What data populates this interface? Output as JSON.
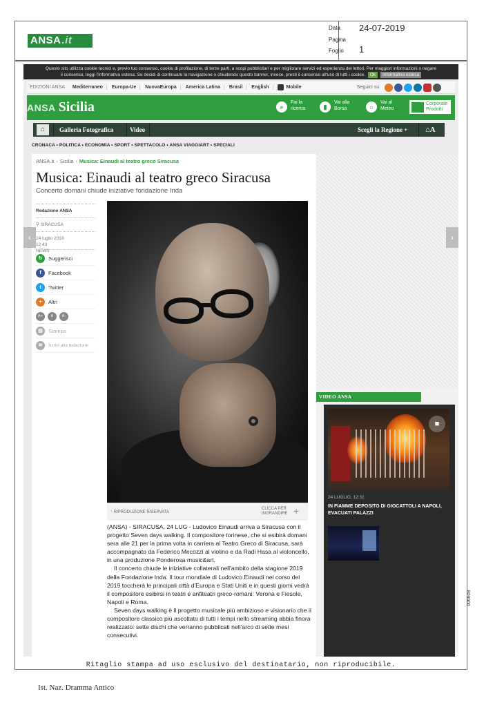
{
  "clip": {
    "logo": "ANSA",
    "logo_suffix": ".it",
    "data_label": "Data",
    "data_value": "24-07-2019",
    "pagina_label": "Pagina",
    "foglio_label": "Foglio",
    "foglio_value": "1",
    "notice": "Ritaglio stampa ad uso esclusivo del destinatario, non riproducibile.",
    "side_code": "006608",
    "source": "Ist. Naz. Dramma Antico"
  },
  "cookie": {
    "text": "Questo sito utilizza cookie tecnici e, previo tuo consenso, cookie di profilazione, di terze parti, a scopi pubblicitari e per migliorare servizi ed esperienza dei lettori. Per maggiori informazioni o negare il consenso, leggi l'informativa estesa. Se decidi di continuare la navigazione o chiudendo questo banner, invece, presti il consenso all'uso di tutti i cookie.",
    "ok": "Ok",
    "info": "Informativa estesa"
  },
  "editions": {
    "label": "EDIZIONI ANSA",
    "items": [
      "Mediterraneo",
      "Europa-Ue",
      "NuovaEuropa",
      "America Latina",
      "Brasil",
      "English"
    ],
    "mobile": "Mobile",
    "follow": "Seguici su:"
  },
  "header": {
    "brand_small": "ANSA",
    "brand": "Sicilia",
    "search": "Fai la ricerca",
    "borsa": "Vai alla Borsa",
    "meteo": "Vai al Meteo",
    "corporate": "Corporate Prodotti"
  },
  "nav": {
    "items": [
      "Galleria Fotografica",
      "Video"
    ],
    "region": "Scegli la Regione +",
    "font": "A"
  },
  "sections": "CRONACA • POLITICA • ECONOMIA • SPORT • SPETTACOLO • ANSA VIAGGIART • SPECIALI",
  "breadcrumb": {
    "root": "ANSA.it",
    "section": "Sicilia",
    "current": "Musica: Einaudi al teatro greco Siracusa"
  },
  "article": {
    "title": "Musica: Einaudi al teatro greco Siracusa",
    "subtitle": "Concerto domani chiude iniziative fondazione Inda",
    "author": "Redazione ANSA",
    "place": "SIRACUSA",
    "date": "24 luglio 2019",
    "time": "12:43",
    "tag": "NEWS",
    "caption": "- RIPRODUZIONE RISERVATA",
    "zoom": "CLICCA PER INGRANDIRE",
    "paragraphs": [
      "(ANSA) - SIRACUSA, 24 LUG - Ludovico Einaudi arriva a Siracusa con il progetto Seven days walking. Il compositore torinese, che si esibirà domani sera alle 21 per la prima volta in carriera al Teatro Greco di Siracusa, sarà accompagnato da Federico Mecozzi al violino e da Radi Hasa al violoncello, in una produzione Ponderosa music&art.",
      "Il concerto chiude le iniziative collaterali nell'ambito della stagione 2019 della Fondazione Inda. Il tour mondiale di Ludovico Einaudi nel corso del 2019 toccherà le principali città d'Europa e Stati Uniti e in questi giorni vedrà il compositore esibirsi in teatri e anfiteatri greco-romani: Verona e Fiesole, Napoli e Roma.",
      "Seven days walking è il progetto musicale più ambizioso e visionario che il compositore classico più ascoltato di tutti i tempi nello streaming abbia finora realizzato: sette dischi che verranno pubblicati nell'arco di sette mesi consecutivi."
    ]
  },
  "share": {
    "suggerisci": "Suggerisci",
    "facebook": "Facebook",
    "twitter": "Twitter",
    "altri": "Altri",
    "font_sizes": [
      "A+",
      "A",
      "A-"
    ],
    "stampa": "Stampa",
    "scrivi": "Scrivi alla redazione"
  },
  "video": {
    "label": "VIDEO ANSA",
    "date": "24 LUGLIO, 12:31",
    "title": "IN FIAMME DEPOSITO DI GIOCATTOLI A NAPOLI, EVACUATI PALAZZI"
  }
}
